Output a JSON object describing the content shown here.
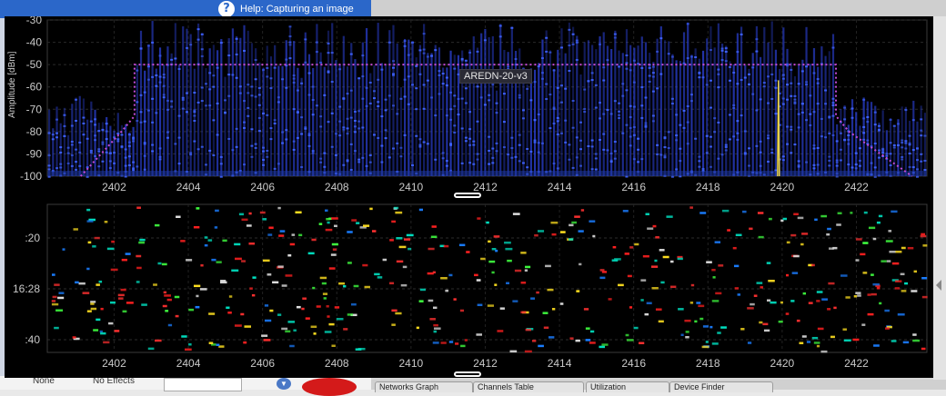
{
  "background": {
    "help_icon": "question-icon",
    "help_link": "Help: Capturing an image",
    "effects_label": "None",
    "effects_value": "No Effects",
    "tabs": [
      "Networks Graph",
      "Channels Table",
      "Utilization",
      "Device Finder"
    ]
  },
  "spectrum": {
    "y_axis_title": "Amplitude [dBm]",
    "y_ticks": [
      "-30",
      "-40",
      "-50",
      "-60",
      "-70",
      "-80",
      "-90",
      "-100"
    ],
    "y_range": [
      -100,
      -30
    ],
    "x_ticks": [
      "2402",
      "2404",
      "2406",
      "2408",
      "2410",
      "2412",
      "2414",
      "2416",
      "2418",
      "2420",
      "2422"
    ],
    "x_range": [
      2400.2,
      2423.9
    ],
    "network_label": "AREDN-20-v3",
    "mask_color": "#c44bd6",
    "signal_color": "#2a3fcf",
    "marker_color": "#e8d24a",
    "marker_freq": 2419.9
  },
  "waterfall": {
    "time_labels": [
      ":20",
      "16:28",
      ":40"
    ],
    "x_ticks": [
      "2402",
      "2404",
      "2406",
      "2408",
      "2410",
      "2412",
      "2414",
      "2416",
      "2418",
      "2420",
      "2422"
    ],
    "dot_colors": [
      "#ff2020",
      "#ff3030",
      "#1a7dff",
      "#00e0c0",
      "#ffe020",
      "#40ff40",
      "#e0e0e0"
    ]
  }
}
